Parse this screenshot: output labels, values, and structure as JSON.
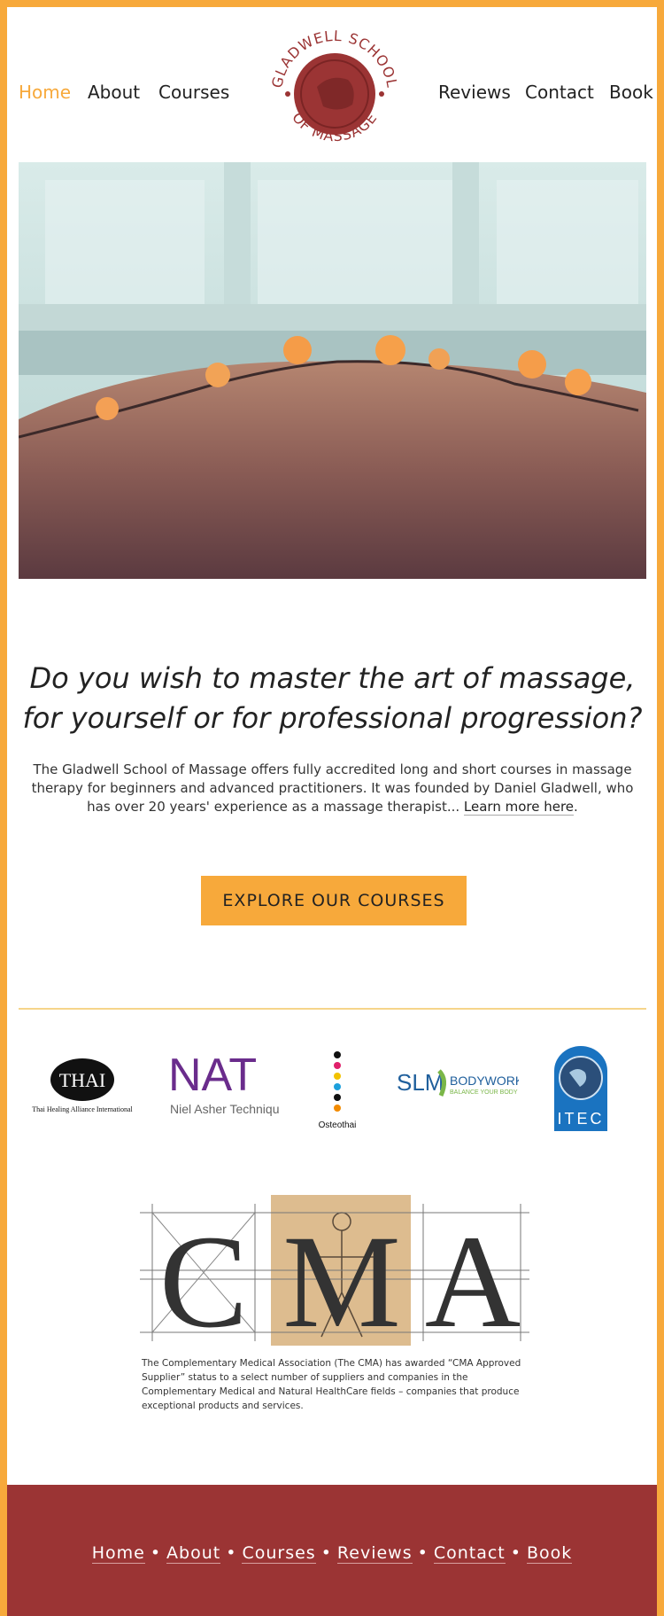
{
  "nav": {
    "left": [
      {
        "label": "Home",
        "active": true
      },
      {
        "label": "About"
      },
      {
        "label": "Courses"
      }
    ],
    "right": [
      {
        "label": "Reviews"
      },
      {
        "label": "Contact"
      },
      {
        "label": "Book"
      }
    ],
    "logo_text": "GLADWELL SCHOOL OF MASSAGE"
  },
  "hero": {
    "alt": "back with flower branch"
  },
  "main": {
    "heading": "Do you wish to master the art of massage, for yourself or for professional progression?",
    "intro_prefix": "The Gladwell School of Massage offers fully accredited long and short courses in massage therapy for beginners and advanced practitioners. It was founded by Daniel Gladwell, who has over 20 years' experience as a massage therapist... ",
    "intro_link": "Learn more here",
    "intro_suffix": ".",
    "cta_label": "EXPLORE OUR COURSES"
  },
  "partners": {
    "thai": {
      "mark": "THAI",
      "caption": "Thai Healing Alliance International"
    },
    "nat": {
      "mark": "NAT",
      "caption": "Niel Asher Technique"
    },
    "osteothai": {
      "caption": "Osteothai"
    },
    "slm": {
      "mark": "SLM",
      "word": "BODYWORK",
      "tagline": "BALANCE YOUR BODY"
    },
    "itec": {
      "mark": "ITEC"
    }
  },
  "cma": {
    "letters": [
      "C",
      "M",
      "A"
    ],
    "text": "The Complementary Medical Association (The CMA) has awarded “CMA Approved Supplier” status to a select number of suppliers and companies in the Complementary Medical and Natural HealthCare fields – companies that produce exceptional products and services."
  },
  "footer": {
    "links": [
      "Home",
      "About",
      "Courses",
      "Reviews",
      "Contact",
      "Book"
    ],
    "separator": "•"
  },
  "colors": {
    "accent": "#f7a93b",
    "brand_red": "#9b3434"
  }
}
